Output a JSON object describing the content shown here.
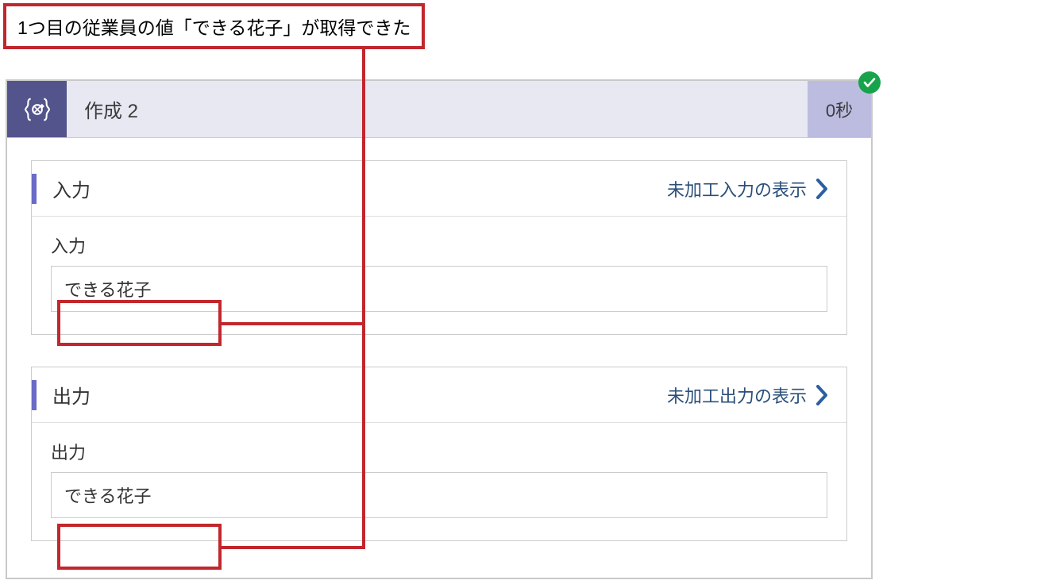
{
  "callout": {
    "text": "1つ目の従業員の値「できる花子」が取得できた"
  },
  "header": {
    "title": "作成 2",
    "duration": "0秒",
    "icon_name": "compose-braces-icon"
  },
  "sections": [
    {
      "head_label": "入力",
      "raw_link_label": "未加工入力の表示",
      "field_label": "入力",
      "field_value": "できる花子"
    },
    {
      "head_label": "出力",
      "raw_link_label": "未加工出力の表示",
      "field_label": "出力",
      "field_value": "できる花子"
    }
  ]
}
